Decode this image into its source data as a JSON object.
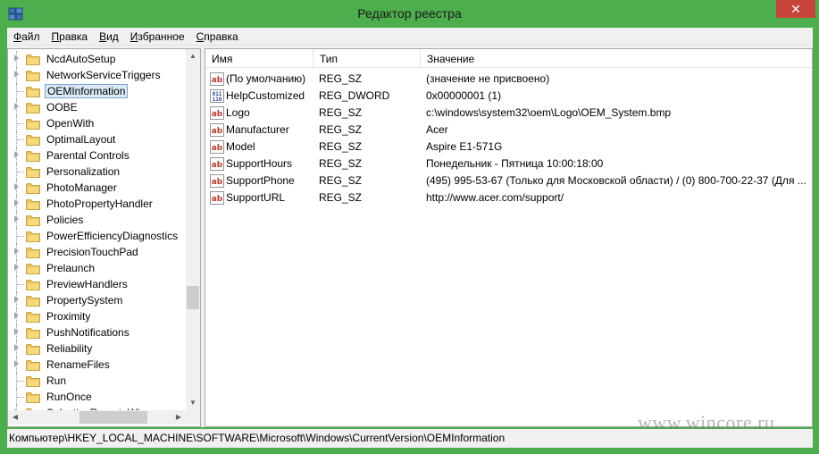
{
  "window": {
    "title": "Редактор реестра",
    "close_glyph": "✕"
  },
  "menu": [
    {
      "accel": "Ф",
      "rest": "айл"
    },
    {
      "accel": "П",
      "rest": "равка"
    },
    {
      "accel": "В",
      "rest": "ид"
    },
    {
      "accel": "И",
      "rest": "збранное"
    },
    {
      "accel": "С",
      "rest": "правка"
    }
  ],
  "tree": {
    "items": [
      {
        "label": "NcdAutoSetup",
        "has_children": true
      },
      {
        "label": "NetworkServiceTriggers",
        "has_children": true
      },
      {
        "label": "OEMInformation",
        "has_children": false,
        "selected": true
      },
      {
        "label": "OOBE",
        "has_children": true
      },
      {
        "label": "OpenWith",
        "has_children": false
      },
      {
        "label": "OptimalLayout",
        "has_children": false
      },
      {
        "label": "Parental Controls",
        "has_children": true
      },
      {
        "label": "Personalization",
        "has_children": false
      },
      {
        "label": "PhotoManager",
        "has_children": true
      },
      {
        "label": "PhotoPropertyHandler",
        "has_children": true
      },
      {
        "label": "Policies",
        "has_children": true
      },
      {
        "label": "PowerEfficiencyDiagnostics",
        "has_children": false
      },
      {
        "label": "PrecisionTouchPad",
        "has_children": true
      },
      {
        "label": "Prelaunch",
        "has_children": true
      },
      {
        "label": "PreviewHandlers",
        "has_children": false
      },
      {
        "label": "PropertySystem",
        "has_children": true
      },
      {
        "label": "Proximity",
        "has_children": true
      },
      {
        "label": "PushNotifications",
        "has_children": true
      },
      {
        "label": "Reliability",
        "has_children": true
      },
      {
        "label": "RenameFiles",
        "has_children": true
      },
      {
        "label": "Run",
        "has_children": false
      },
      {
        "label": "RunOnce",
        "has_children": false
      },
      {
        "label": "SelectiveRemoteWipe",
        "has_children": true
      }
    ],
    "scroll_position": 0.72
  },
  "values": {
    "headers": {
      "name": "Имя",
      "type": "Тип",
      "data": "Значение"
    },
    "rows": [
      {
        "icon": "string-value-icon",
        "name": "(По умолчанию)",
        "type": "REG_SZ",
        "data": "(значение не присвоено)"
      },
      {
        "icon": "binary-value-icon",
        "name": "HelpCustomized",
        "type": "REG_DWORD",
        "data": "0x00000001 (1)"
      },
      {
        "icon": "string-value-icon",
        "name": "Logo",
        "type": "REG_SZ",
        "data": "c:\\windows\\system32\\oem\\Logo\\OEM_System.bmp"
      },
      {
        "icon": "string-value-icon",
        "name": "Manufacturer",
        "type": "REG_SZ",
        "data": "Acer"
      },
      {
        "icon": "string-value-icon",
        "name": "Model",
        "type": "REG_SZ",
        "data": "Aspire E1-571G"
      },
      {
        "icon": "string-value-icon",
        "name": "SupportHours",
        "type": "REG_SZ",
        "data": "Понедельник - Пятница 10:00:18:00"
      },
      {
        "icon": "string-value-icon",
        "name": "SupportPhone",
        "type": "REG_SZ",
        "data": "(495) 995-53-67 (Только для Московской области) / (0) 800-700-22-37 (Для ..."
      },
      {
        "icon": "string-value-icon",
        "name": "SupportURL",
        "type": "REG_SZ",
        "data": "http://www.acer.com/support/"
      }
    ]
  },
  "status": {
    "path": "Компьютер\\HKEY_LOCAL_MACHINE\\SOFTWARE\\Microsoft\\Windows\\CurrentVersion\\OEMInformation"
  },
  "watermark": "www.wincore.ru",
  "colors": {
    "chrome": "#4cae4c",
    "close": "#c7433a",
    "selection": "#dceaf8",
    "folder": "#e8c45c"
  }
}
